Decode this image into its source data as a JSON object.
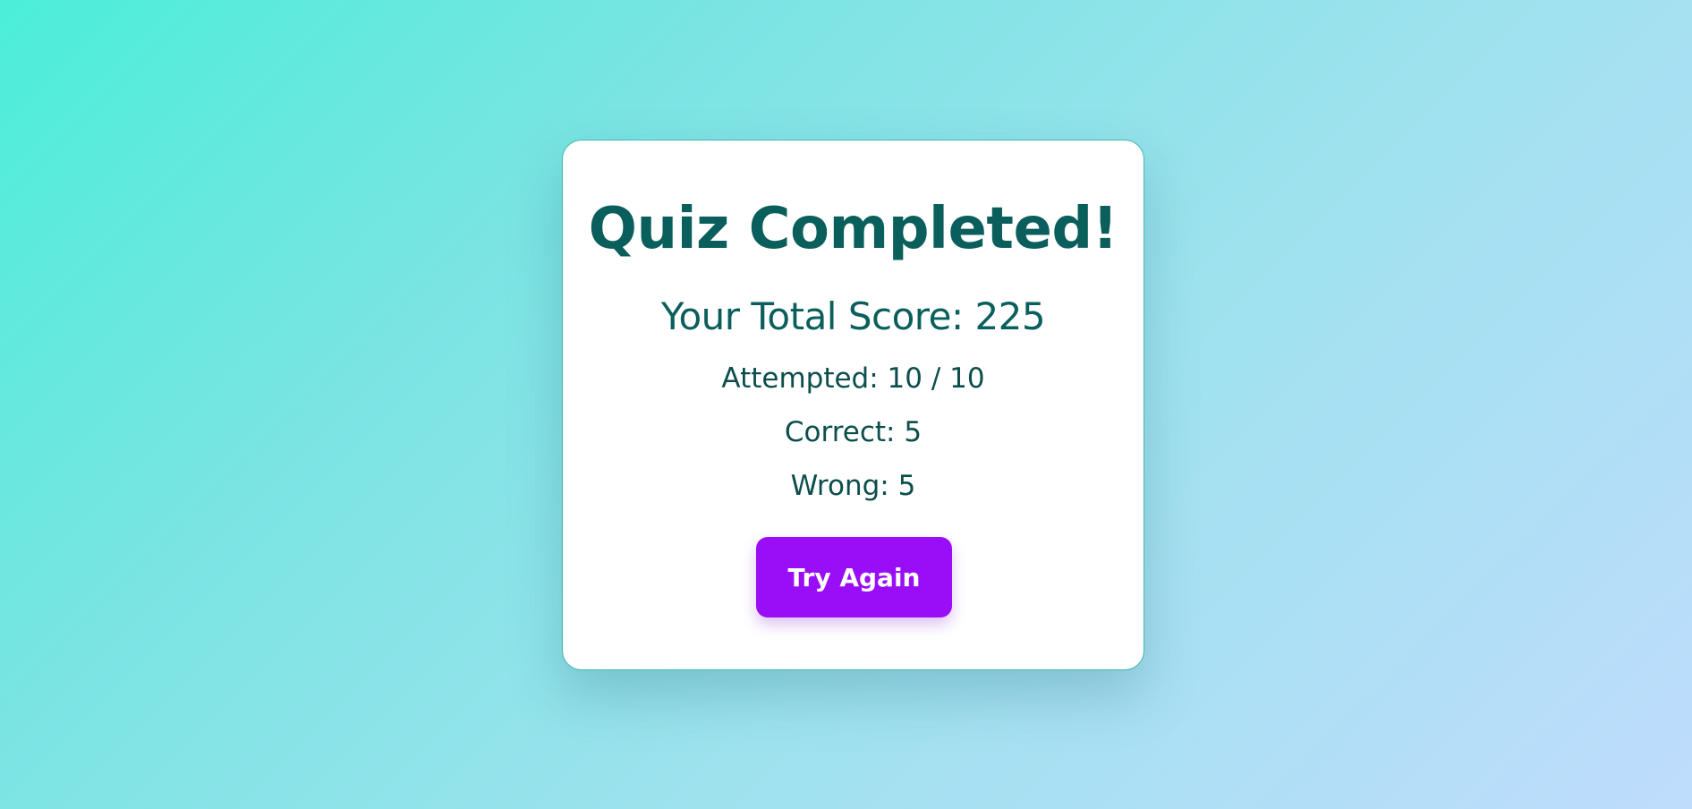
{
  "result": {
    "title": "Quiz Completed!",
    "score_text": "Your Total Score: 225",
    "attempted_text": "Attempted: 10 / 10",
    "correct_text": "Correct: 5",
    "wrong_text": "Wrong: 5",
    "retry_label": "Try Again"
  },
  "colors": {
    "accent": "#9a0ef7",
    "text_primary": "#0a5f5c",
    "card_border": "#3fb8b0"
  }
}
